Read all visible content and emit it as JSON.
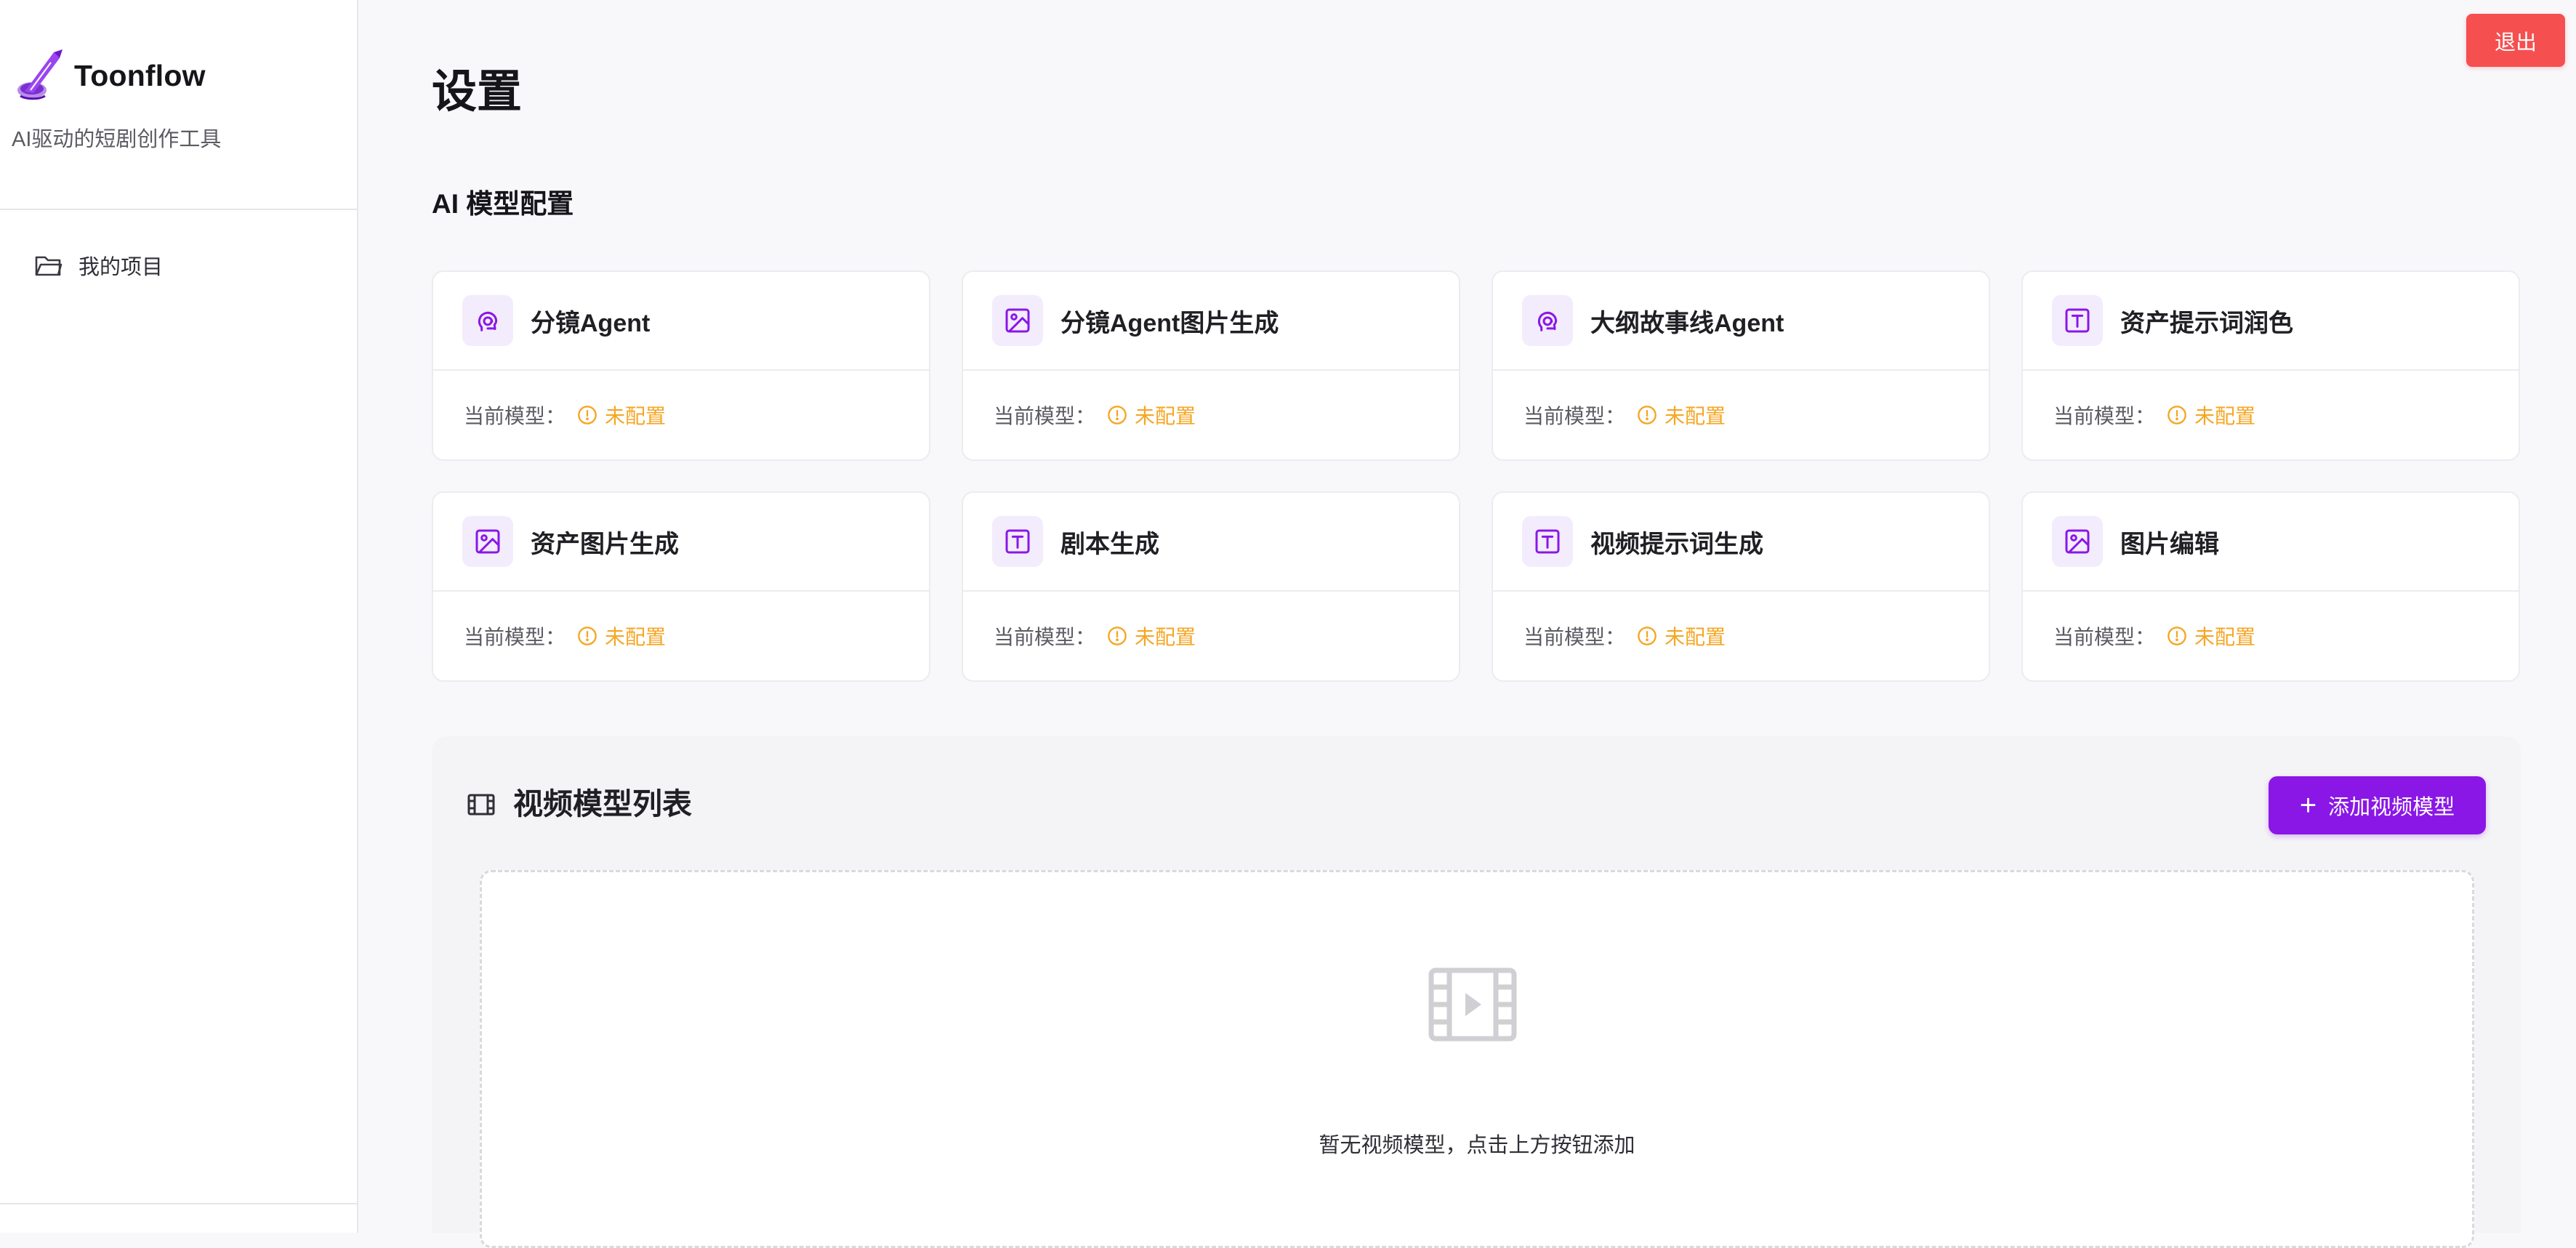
{
  "app": {
    "brand_name": "Toonflow",
    "tagline": "AI驱动的短剧创作工具",
    "logo_icon": "quill-pen-icon"
  },
  "sidebar": {
    "items": [
      {
        "label": "我的项目",
        "icon": "folder-icon"
      }
    ]
  },
  "header": {
    "logout_label": "退出"
  },
  "main": {
    "page_title": "设置",
    "ai_section_title": "AI 模型配置",
    "model_label": "当前模型：",
    "cards": [
      {
        "title": "分镜Agent",
        "icon": "brain-icon",
        "status": "未配置"
      },
      {
        "title": "分镜Agent图片生成",
        "icon": "image-icon",
        "status": "未配置"
      },
      {
        "title": "大纲故事线Agent",
        "icon": "brain-icon",
        "status": "未配置"
      },
      {
        "title": "资产提示词润色",
        "icon": "text-icon",
        "status": "未配置"
      },
      {
        "title": "资产图片生成",
        "icon": "image-icon",
        "status": "未配置"
      },
      {
        "title": "剧本生成",
        "icon": "text-icon",
        "status": "未配置"
      },
      {
        "title": "视频提示词生成",
        "icon": "text-icon",
        "status": "未配置"
      },
      {
        "title": "图片编辑",
        "icon": "image-icon",
        "status": "未配置"
      }
    ],
    "video_section": {
      "title": "视频模型列表",
      "add_button_label": "添加视频模型",
      "empty_text": "暂无视频模型，点击上方按钮添加"
    }
  },
  "colors": {
    "accent": "#8a17e6",
    "danger": "#f64f4f",
    "warning": "#f5a623",
    "icon_bg": "#f3ecfc"
  }
}
